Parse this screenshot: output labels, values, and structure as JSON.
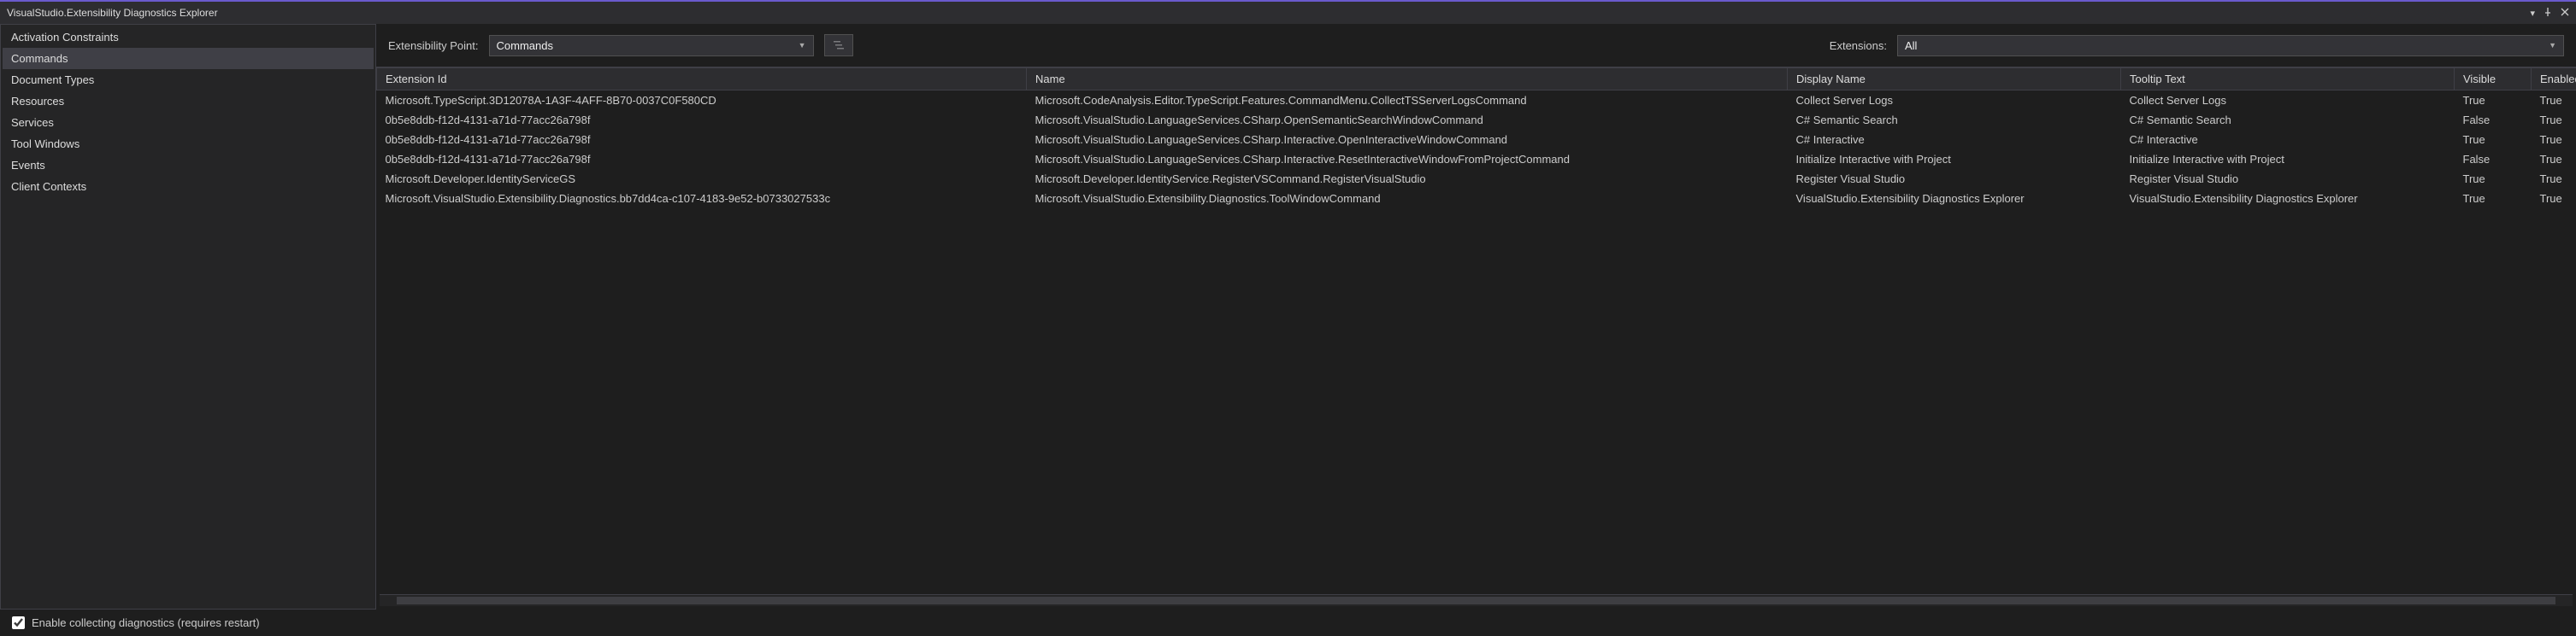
{
  "window": {
    "title": "VisualStudio.Extensibility Diagnostics Explorer"
  },
  "sidebar": {
    "items": [
      {
        "label": "Activation Constraints"
      },
      {
        "label": "Commands"
      },
      {
        "label": "Document Types"
      },
      {
        "label": "Resources"
      },
      {
        "label": "Services"
      },
      {
        "label": "Tool Windows"
      },
      {
        "label": "Events"
      },
      {
        "label": "Client Contexts"
      }
    ],
    "active_index": 1
  },
  "filters": {
    "point_label": "Extensibility Point:",
    "point_value": "Commands",
    "extensions_label": "Extensions:",
    "extensions_value": "All"
  },
  "grid": {
    "headers": [
      "Extension Id",
      "Name",
      "Display Name",
      "Tooltip Text",
      "Visible",
      "Enabled"
    ],
    "rows": [
      {
        "extension_id": "Microsoft.TypeScript.3D12078A-1A3F-4AFF-8B70-0037C0F580CD",
        "name": "Microsoft.CodeAnalysis.Editor.TypeScript.Features.CommandMenu.CollectTSServerLogsCommand",
        "display": "Collect Server Logs",
        "tooltip": "Collect Server Logs",
        "visible": "True",
        "enabled": "True"
      },
      {
        "extension_id": "0b5e8ddb-f12d-4131-a71d-77acc26a798f",
        "name": "Microsoft.VisualStudio.LanguageServices.CSharp.OpenSemanticSearchWindowCommand",
        "display": "C# Semantic Search",
        "tooltip": "C# Semantic Search",
        "visible": "False",
        "enabled": "True"
      },
      {
        "extension_id": "0b5e8ddb-f12d-4131-a71d-77acc26a798f",
        "name": "Microsoft.VisualStudio.LanguageServices.CSharp.Interactive.OpenInteractiveWindowCommand",
        "display": "C# Interactive",
        "tooltip": "C# Interactive",
        "visible": "True",
        "enabled": "True"
      },
      {
        "extension_id": "0b5e8ddb-f12d-4131-a71d-77acc26a798f",
        "name": "Microsoft.VisualStudio.LanguageServices.CSharp.Interactive.ResetInteractiveWindowFromProjectCommand",
        "display": "Initialize Interactive with Project",
        "tooltip": "Initialize Interactive with Project",
        "visible": "False",
        "enabled": "True"
      },
      {
        "extension_id": "Microsoft.Developer.IdentityServiceGS",
        "name": "Microsoft.Developer.IdentityService.RegisterVSCommand.RegisterVisualStudio",
        "display": "Register Visual Studio",
        "tooltip": "Register Visual Studio",
        "visible": "True",
        "enabled": "True"
      },
      {
        "extension_id": "Microsoft.VisualStudio.Extensibility.Diagnostics.bb7dd4ca-c107-4183-9e52-b0733027533c",
        "name": "Microsoft.VisualStudio.Extensibility.Diagnostics.ToolWindowCommand",
        "display": "VisualStudio.Extensibility Diagnostics Explorer",
        "tooltip": "VisualStudio.Extensibility Diagnostics Explorer",
        "visible": "True",
        "enabled": "True"
      }
    ]
  },
  "footer": {
    "checkbox_label": "Enable collecting diagnostics (requires restart)",
    "checkbox_checked": true
  }
}
